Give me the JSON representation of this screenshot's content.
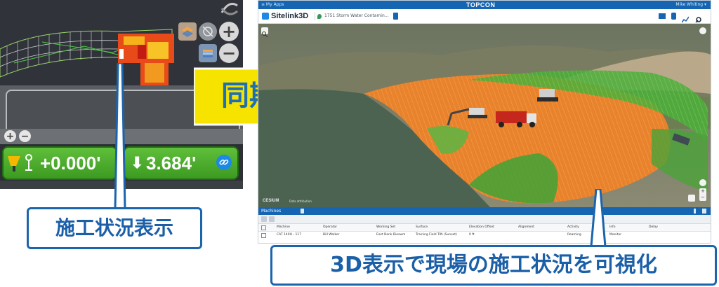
{
  "machine_display": {
    "cut_fill_value": "+0.000'",
    "elevation_value": "3.684'",
    "elevation_arrow": "⬇",
    "zoom_in": "+",
    "zoom_out": "−",
    "icons": [
      "layers-icon",
      "gps-off-icon",
      "grid-icon",
      "zoom-in-icon",
      "zoom-out-icon",
      "excavator-icon",
      "gps-antenna-icon",
      "link-icon",
      "rotate-icon"
    ]
  },
  "sync_arrow": {
    "label": "同期",
    "color": "#f7e300"
  },
  "callouts": {
    "left": "施工状況表示",
    "right": "3D表示で現場の施工状況を可視化"
  },
  "sitelink": {
    "topbar": {
      "menu": "≡  My Apps",
      "logo": "TOPCON",
      "user": "Mike Whiting  ▾"
    },
    "brand": "Sitelink3D",
    "project": "1751 Storm Water Contamin…",
    "cesium": "CESIUM",
    "cesium_sub": "Data attribution",
    "machines_panel": {
      "title": "Machines",
      "columns": [
        "Machine",
        "Operator",
        "Working Set",
        "Surface",
        "Elevation Offset",
        "Alignment",
        "Activity",
        "Info",
        "Delay"
      ],
      "rows": [
        [
          "CAT 140H - 117",
          "Bill Walker",
          "East Bank Bioswm",
          "Training Field TIN (Sunset)",
          "0 ft",
          "",
          "Roaming",
          "Monitor",
          ""
        ]
      ]
    }
  },
  "colors": {
    "topcon_blue": "#1665b3",
    "callout_blue": "#1a65ad",
    "readout_green": "#4caf2e"
  }
}
